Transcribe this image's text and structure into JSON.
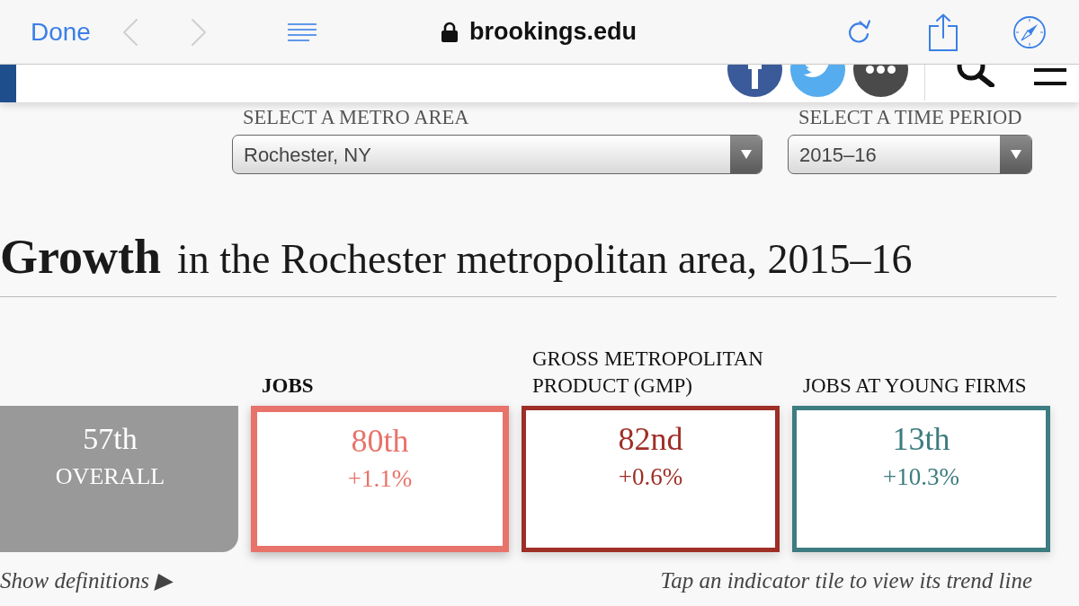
{
  "browser_bar": {
    "done": "Done",
    "back": {
      "disabled": true
    },
    "forward": {
      "disabled": true
    },
    "address": "brookings.edu"
  },
  "selectors": [
    {
      "label": "SELECT A METRO AREA",
      "value": "Rochester, NY"
    },
    {
      "label": "SELECT A TIME PERIOD",
      "value": "2015–16"
    }
  ],
  "heading": {
    "title": "Growth",
    "subtitle": "in the Rochester metropolitan area, 2015–16"
  },
  "overall": {
    "rank": "57th",
    "label": "OVERALL"
  },
  "indicators": [
    {
      "label": "JOBS",
      "rank": "80th",
      "change": "+1.1%",
      "color": "#e8736a",
      "selected": true
    },
    {
      "label": "GROSS METROPOLITAN PRODUCT (GMP)",
      "rank": "82nd",
      "change": "+0.6%",
      "color": "#9e2f27",
      "selected": false
    },
    {
      "label": "JOBS AT YOUNG FIRMS",
      "rank": "13th",
      "change": "+10.3%",
      "color": "#3d7c80",
      "selected": false
    }
  ],
  "footer": {
    "definitions_link": "Show definitions ▶",
    "hint": "Tap an indicator tile to view its trend line"
  }
}
